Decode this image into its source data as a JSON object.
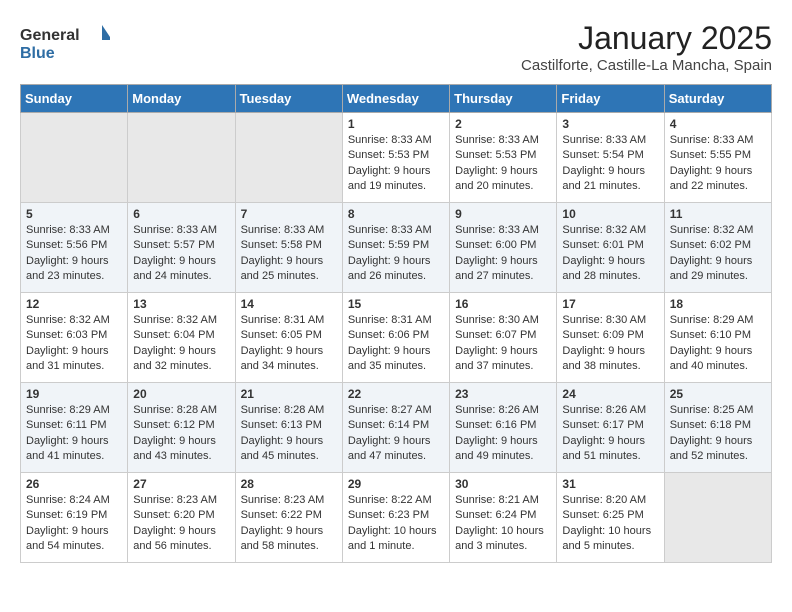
{
  "header": {
    "logo_general": "General",
    "logo_blue": "Blue",
    "month_title": "January 2025",
    "location": "Castilforte, Castille-La Mancha, Spain"
  },
  "weekdays": [
    "Sunday",
    "Monday",
    "Tuesday",
    "Wednesday",
    "Thursday",
    "Friday",
    "Saturday"
  ],
  "weeks": [
    [
      {
        "day": "",
        "info": ""
      },
      {
        "day": "",
        "info": ""
      },
      {
        "day": "",
        "info": ""
      },
      {
        "day": "1",
        "info": "Sunrise: 8:33 AM\nSunset: 5:53 PM\nDaylight: 9 hours\nand 19 minutes."
      },
      {
        "day": "2",
        "info": "Sunrise: 8:33 AM\nSunset: 5:53 PM\nDaylight: 9 hours\nand 20 minutes."
      },
      {
        "day": "3",
        "info": "Sunrise: 8:33 AM\nSunset: 5:54 PM\nDaylight: 9 hours\nand 21 minutes."
      },
      {
        "day": "4",
        "info": "Sunrise: 8:33 AM\nSunset: 5:55 PM\nDaylight: 9 hours\nand 22 minutes."
      }
    ],
    [
      {
        "day": "5",
        "info": "Sunrise: 8:33 AM\nSunset: 5:56 PM\nDaylight: 9 hours\nand 23 minutes."
      },
      {
        "day": "6",
        "info": "Sunrise: 8:33 AM\nSunset: 5:57 PM\nDaylight: 9 hours\nand 24 minutes."
      },
      {
        "day": "7",
        "info": "Sunrise: 8:33 AM\nSunset: 5:58 PM\nDaylight: 9 hours\nand 25 minutes."
      },
      {
        "day": "8",
        "info": "Sunrise: 8:33 AM\nSunset: 5:59 PM\nDaylight: 9 hours\nand 26 minutes."
      },
      {
        "day": "9",
        "info": "Sunrise: 8:33 AM\nSunset: 6:00 PM\nDaylight: 9 hours\nand 27 minutes."
      },
      {
        "day": "10",
        "info": "Sunrise: 8:32 AM\nSunset: 6:01 PM\nDaylight: 9 hours\nand 28 minutes."
      },
      {
        "day": "11",
        "info": "Sunrise: 8:32 AM\nSunset: 6:02 PM\nDaylight: 9 hours\nand 29 minutes."
      }
    ],
    [
      {
        "day": "12",
        "info": "Sunrise: 8:32 AM\nSunset: 6:03 PM\nDaylight: 9 hours\nand 31 minutes."
      },
      {
        "day": "13",
        "info": "Sunrise: 8:32 AM\nSunset: 6:04 PM\nDaylight: 9 hours\nand 32 minutes."
      },
      {
        "day": "14",
        "info": "Sunrise: 8:31 AM\nSunset: 6:05 PM\nDaylight: 9 hours\nand 34 minutes."
      },
      {
        "day": "15",
        "info": "Sunrise: 8:31 AM\nSunset: 6:06 PM\nDaylight: 9 hours\nand 35 minutes."
      },
      {
        "day": "16",
        "info": "Sunrise: 8:30 AM\nSunset: 6:07 PM\nDaylight: 9 hours\nand 37 minutes."
      },
      {
        "day": "17",
        "info": "Sunrise: 8:30 AM\nSunset: 6:09 PM\nDaylight: 9 hours\nand 38 minutes."
      },
      {
        "day": "18",
        "info": "Sunrise: 8:29 AM\nSunset: 6:10 PM\nDaylight: 9 hours\nand 40 minutes."
      }
    ],
    [
      {
        "day": "19",
        "info": "Sunrise: 8:29 AM\nSunset: 6:11 PM\nDaylight: 9 hours\nand 41 minutes."
      },
      {
        "day": "20",
        "info": "Sunrise: 8:28 AM\nSunset: 6:12 PM\nDaylight: 9 hours\nand 43 minutes."
      },
      {
        "day": "21",
        "info": "Sunrise: 8:28 AM\nSunset: 6:13 PM\nDaylight: 9 hours\nand 45 minutes."
      },
      {
        "day": "22",
        "info": "Sunrise: 8:27 AM\nSunset: 6:14 PM\nDaylight: 9 hours\nand 47 minutes."
      },
      {
        "day": "23",
        "info": "Sunrise: 8:26 AM\nSunset: 6:16 PM\nDaylight: 9 hours\nand 49 minutes."
      },
      {
        "day": "24",
        "info": "Sunrise: 8:26 AM\nSunset: 6:17 PM\nDaylight: 9 hours\nand 51 minutes."
      },
      {
        "day": "25",
        "info": "Sunrise: 8:25 AM\nSunset: 6:18 PM\nDaylight: 9 hours\nand 52 minutes."
      }
    ],
    [
      {
        "day": "26",
        "info": "Sunrise: 8:24 AM\nSunset: 6:19 PM\nDaylight: 9 hours\nand 54 minutes."
      },
      {
        "day": "27",
        "info": "Sunrise: 8:23 AM\nSunset: 6:20 PM\nDaylight: 9 hours\nand 56 minutes."
      },
      {
        "day": "28",
        "info": "Sunrise: 8:23 AM\nSunset: 6:22 PM\nDaylight: 9 hours\nand 58 minutes."
      },
      {
        "day": "29",
        "info": "Sunrise: 8:22 AM\nSunset: 6:23 PM\nDaylight: 10 hours\nand 1 minute."
      },
      {
        "day": "30",
        "info": "Sunrise: 8:21 AM\nSunset: 6:24 PM\nDaylight: 10 hours\nand 3 minutes."
      },
      {
        "day": "31",
        "info": "Sunrise: 8:20 AM\nSunset: 6:25 PM\nDaylight: 10 hours\nand 5 minutes."
      },
      {
        "day": "",
        "info": ""
      }
    ]
  ]
}
